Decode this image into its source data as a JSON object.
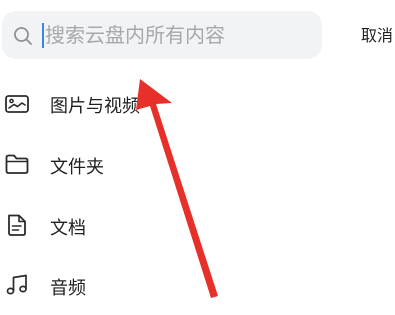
{
  "search": {
    "placeholder": "搜索云盘内所有内容",
    "value": "",
    "cancel_label": "取消"
  },
  "categories": [
    {
      "label": "图片与视频",
      "icon": "image-icon"
    },
    {
      "label": "文件夹",
      "icon": "folder-icon"
    },
    {
      "label": "文档",
      "icon": "document-icon"
    },
    {
      "label": "音频",
      "icon": "music-note-icon"
    }
  ],
  "annotation": {
    "arrow_color": "#e8302a"
  }
}
